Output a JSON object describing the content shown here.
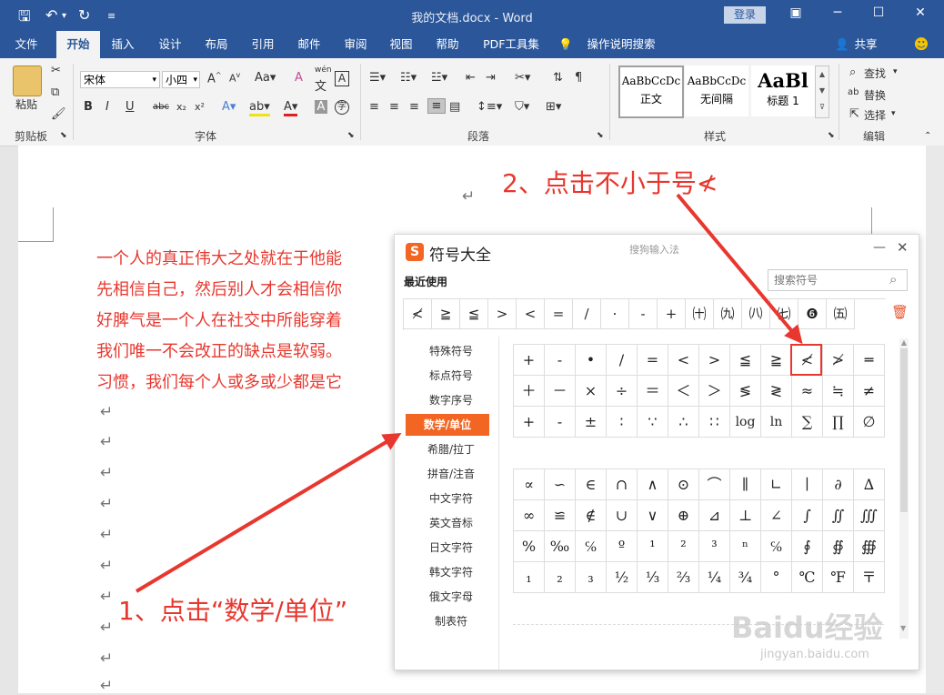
{
  "titlebar": {
    "title": "我的文档.docx  -  Word",
    "login": "登录",
    "qa_icons": [
      "save-icon",
      "undo-icon",
      "redo-icon",
      "customize-icon"
    ]
  },
  "tabs": [
    "文件",
    "开始",
    "插入",
    "设计",
    "布局",
    "引用",
    "邮件",
    "审阅",
    "视图",
    "帮助",
    "PDF工具集",
    "操作说明搜索"
  ],
  "share": "共享",
  "ribbon": {
    "clipboard": {
      "label": "剪贴板",
      "paste": "粘贴"
    },
    "font": {
      "label": "字体",
      "font_name": "宋体",
      "font_size": "小四",
      "wen": "wén"
    },
    "paragraph": {
      "label": "段落"
    },
    "styles": {
      "label": "样式",
      "items": [
        {
          "preview": "AaBbCcDc",
          "name": "正文"
        },
        {
          "preview": "AaBbCcDc",
          "name": "无间隔"
        },
        {
          "preview": "AaBl",
          "name": "标题 1"
        }
      ]
    },
    "editing": {
      "label": "编辑",
      "find": "查找",
      "replace": "替换",
      "select": "选择"
    }
  },
  "document": {
    "lines": [
      "一个人的真正伟大之处就在于他能",
      "先相信自己，然后别人才会相信你",
      "好脾气是一个人在社交中所能穿着",
      "我们唯一不会改正的缺点是软弱。",
      "习惯，我们每个人或多或少都是它"
    ],
    "return_mark": "↵"
  },
  "panel": {
    "title": "符号大全",
    "subtitle": "搜狗输入法",
    "recent_label": "最近使用",
    "search_placeholder": "搜索符号",
    "recent": [
      "≮",
      "≧",
      "≦",
      ">",
      "<",
      "=",
      "/",
      "·",
      "-",
      "+",
      "㈩",
      "㈨",
      "㈧",
      "㈦",
      "❻",
      "㈤"
    ],
    "categories": [
      "特殊符号",
      "标点符号",
      "数字序号",
      "数学/单位",
      "希腊/拉丁",
      "拼音/注音",
      "中文字符",
      "英文音标",
      "日文字符",
      "韩文字符",
      "俄文字母",
      "制表符"
    ],
    "selected_category": "数学/单位",
    "grid1": [
      [
        "+",
        "-",
        "•",
        "/",
        "=",
        "<",
        ">",
        "≦",
        "≧",
        "≮",
        "≯",
        "═"
      ],
      [
        "＋",
        "－",
        "×",
        "÷",
        "＝",
        "＜",
        "＞",
        "≶",
        "≷",
        "≈",
        "≒",
        "≠"
      ],
      [
        "+",
        "-",
        "±",
        "∶",
        "∵",
        "∴",
        "∷",
        "log",
        "ln",
        "∑",
        "∏",
        "∅"
      ]
    ],
    "grid2": [
      [
        "∝",
        "∽",
        "∈",
        "∩",
        "∧",
        "⊙",
        "⌒",
        "∥",
        "∟",
        "∣",
        "∂",
        "∆"
      ],
      [
        "∞",
        "≌",
        "∉",
        "∪",
        "∨",
        "⊕",
        "⊿",
        "⊥",
        "∠",
        "∫",
        "∬",
        "∭"
      ],
      [
        "%",
        "‰",
        "℅",
        "º",
        "¹",
        "²",
        "³",
        "ⁿ",
        "℅",
        "∮",
        "∯",
        "∰"
      ],
      [
        "₁",
        "₂",
        "₃",
        "½",
        "⅓",
        "⅔",
        "¼",
        "¾",
        "°",
        "℃",
        "℉",
        "〒"
      ]
    ]
  },
  "annotations": {
    "a1": "1、点击“数学/单位”",
    "a2": "2、点击不小于号≮"
  },
  "watermark": {
    "brand": "Baidu经验",
    "url": "jingyan.baidu.com"
  }
}
